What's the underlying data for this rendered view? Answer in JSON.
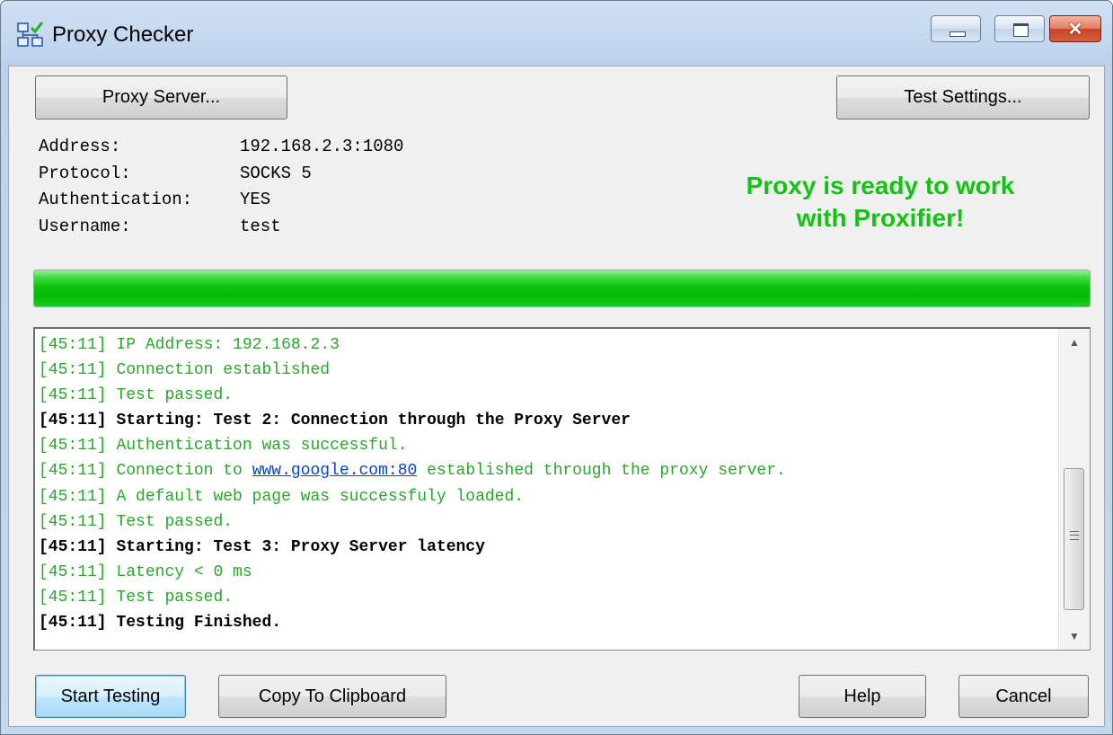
{
  "window": {
    "title": "Proxy Checker"
  },
  "buttons": {
    "proxy_server": "Proxy Server...",
    "test_settings": "Test Settings...",
    "start_testing": "Start Testing",
    "copy_clipboard": "Copy To Clipboard",
    "help": "Help",
    "cancel": "Cancel"
  },
  "proxy_info": [
    {
      "label": "Address:",
      "value": "192.168.2.3:1080"
    },
    {
      "label": "Protocol:",
      "value": "SOCKS 5"
    },
    {
      "label": "Authentication:",
      "value": "YES"
    },
    {
      "label": "Username:",
      "value": "test"
    }
  ],
  "status": {
    "line1": "Proxy is ready to work",
    "line2": "with Proxifier!",
    "color": "#10c410"
  },
  "progress": {
    "percent": 100
  },
  "log": [
    {
      "time": "[45:11]",
      "text": "IP Address: 192.168.2.3",
      "style": "ok"
    },
    {
      "time": "[45:11]",
      "text": "Connection established",
      "style": "ok"
    },
    {
      "time": "[45:11]",
      "text": "Test passed.",
      "style": "ok"
    },
    {
      "time": "[45:11]",
      "text": "Starting: Test 2: Connection through the Proxy Server",
      "style": "bold"
    },
    {
      "time": "[45:11]",
      "text": "Authentication was successful.",
      "style": "ok"
    },
    {
      "time": "[45:11]",
      "text_before": "Connection to",
      "link": "www.google.com:80",
      "text_after": "established through the proxy server.",
      "style": "ok"
    },
    {
      "time": "[45:11]",
      "text": "A default web page was successfuly loaded.",
      "style": "ok"
    },
    {
      "time": "[45:11]",
      "text": "Test passed.",
      "style": "ok"
    },
    {
      "time": "[45:11]",
      "text": "Starting: Test 3: Proxy Server latency",
      "style": "bold"
    },
    {
      "time": "[45:11]",
      "text": "Latency < 0 ms",
      "style": "ok"
    },
    {
      "time": "[45:11]",
      "text": "Test passed.",
      "style": "ok"
    },
    {
      "time": "[45:11]",
      "text": "Testing Finished.",
      "style": "bold"
    }
  ]
}
